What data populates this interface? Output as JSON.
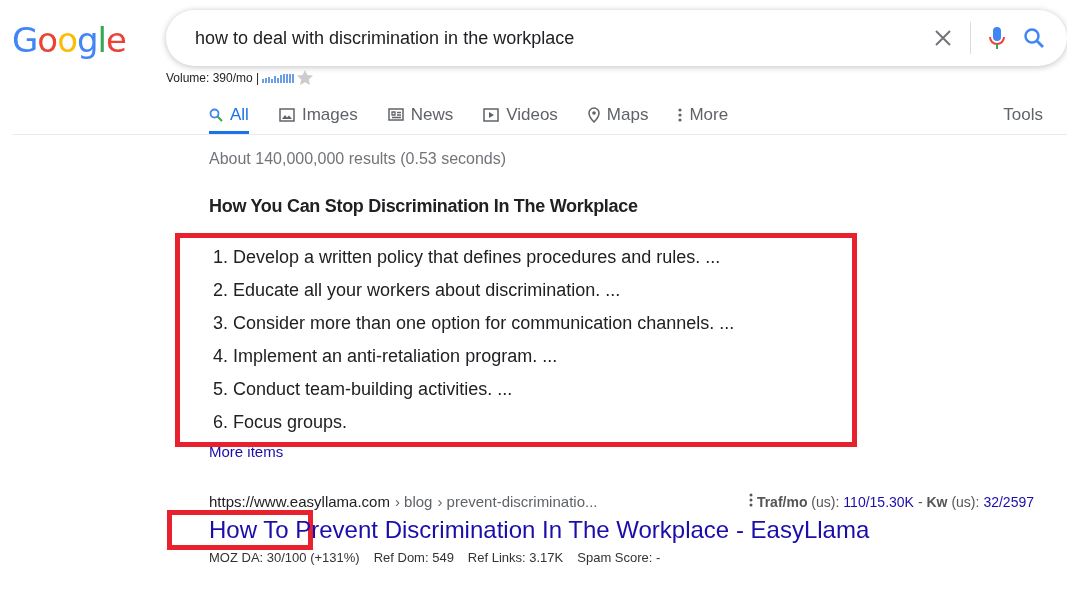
{
  "logo": "Google",
  "search": {
    "value": "how to deal with discrimination in the workplace"
  },
  "volume": {
    "text": "Volume: 390/mo |"
  },
  "tabs": [
    {
      "label": "All",
      "kind": "search",
      "selected": true
    },
    {
      "label": "Images",
      "kind": "image",
      "selected": false
    },
    {
      "label": "News",
      "kind": "news",
      "selected": false
    },
    {
      "label": "Videos",
      "kind": "video",
      "selected": false
    },
    {
      "label": "Maps",
      "kind": "pin",
      "selected": false
    },
    {
      "label": "More",
      "kind": "dots",
      "selected": false
    }
  ],
  "tools": "Tools",
  "stats": "About 140,000,000 results (0.53 seconds)",
  "snippet": {
    "title": "How You Can Stop Discrimination In The Workplace",
    "items": [
      "1. Develop a written policy that defines procedures and rules. ...",
      "2. Educate all your workers about discrimination. ...",
      "3. Consider more than one option for communication channels. ...",
      "4. Implement an anti-retaliation program. ...",
      "5. Conduct team-building activities. ...",
      "6. Focus groups."
    ],
    "more": "More items"
  },
  "result": {
    "url": "https://www.easyllama.com",
    "crumbs": [
      "› blog",
      "› prevent-discriminatio..."
    ],
    "metrics": [
      {
        "label": "**Traf/mo** (us):",
        "value": "110/15.30K"
      },
      {
        "label": "- **Kw** (us):",
        "value": "32/2597"
      }
    ],
    "title": "How To Prevent Discrimination In The Workplace - EasyLlama",
    "seo": [
      "MOZ DA: 30/100 (+131%)",
      "Ref Dom: 549",
      "Ref Links: 3.17K",
      "Spam Score: -"
    ]
  }
}
